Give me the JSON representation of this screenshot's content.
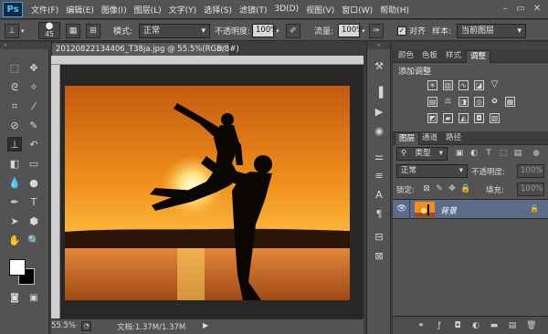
{
  "app": {
    "logo": "Ps"
  },
  "menubar": {
    "items": [
      "文件(F)",
      "编辑(E)",
      "图像(I)",
      "图层(L)",
      "文字(Y)",
      "选择(S)",
      "滤镜(T)",
      "3D(D)",
      "视图(V)",
      "窗口(W)",
      "帮助(H)"
    ],
    "minimize": "–",
    "restore": "▭",
    "close": "✕"
  },
  "options_bar": {
    "brush_size": "45",
    "mode_label": "模式:",
    "mode_value": "正常",
    "opacity_label": "不透明度:",
    "opacity_value": "100%",
    "flow_label": "流量:",
    "flow_value": "100%",
    "aligned_label": "对齐",
    "sample_label": "样本:",
    "sample_value": "当前图层"
  },
  "document": {
    "tab_title": "20120822134406_T38ja.jpg @ 55.5%(RGB/8#)",
    "tab_close": "×",
    "zoom": "55.5%",
    "doc_info": "文档:1.37M/1.37M"
  },
  "adjustments_panel": {
    "tabs": [
      "颜色",
      "色板",
      "样式",
      "调整"
    ],
    "selected_tab": "调整",
    "title": "添加调整",
    "row1_icons": [
      "brightness-contrast",
      "levels",
      "curves",
      "exposure"
    ],
    "row2_icons": [
      "vibrance",
      "hue-saturation",
      "color-balance",
      "black-white",
      "photo-filter",
      "channel-mixer",
      "color-lookup"
    ],
    "row3_icons": [
      "invert",
      "posterize",
      "threshold",
      "selective-color",
      "gradient-map"
    ]
  },
  "layers_panel": {
    "tabs": [
      "图层",
      "通道",
      "路径"
    ],
    "selected_tab": "图层",
    "filter_kind": "类型",
    "blend_mode": "正常",
    "opacity_label": "不透明度:",
    "opacity_value": "100%",
    "lock_label": "锁定:",
    "fill_label": "填充:",
    "fill_value": "100%",
    "layers": [
      {
        "name": "背景",
        "visible": true,
        "locked": true
      }
    ]
  },
  "colors": {
    "accent_selected_layer": "#5b6c8a",
    "foreground": "#ffffff",
    "background": "#000000"
  }
}
